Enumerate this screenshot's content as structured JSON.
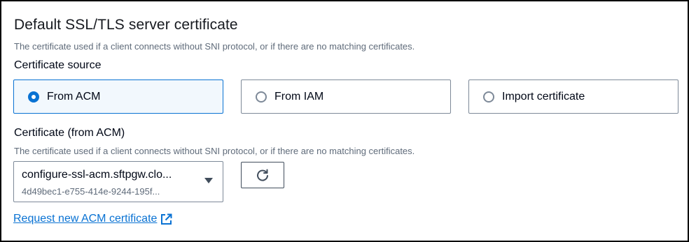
{
  "section": {
    "title": "Default SSL/TLS server certificate",
    "description": "The certificate used if a client connects without SNI protocol, or if there are no matching certificates."
  },
  "certificate_source": {
    "label": "Certificate source",
    "options": [
      {
        "label": "From ACM",
        "selected": true
      },
      {
        "label": "From IAM",
        "selected": false
      },
      {
        "label": "Import certificate",
        "selected": false
      }
    ]
  },
  "certificate": {
    "label": "Certificate (from ACM)",
    "description": "The certificate used if a client connects without SNI protocol, or if there are no matching certificates.",
    "selected_value": "configure-ssl-acm.sftpgw.clo...",
    "selected_id": "4d49bec1-e755-414e-9244-195f...",
    "dropdown_icon": "caret-down-icon",
    "refresh_icon": "refresh-icon"
  },
  "link": {
    "label": "Request new ACM certificate",
    "icon": "external-link-icon"
  },
  "colors": {
    "accent": "#0972d3",
    "selected_bg": "#f2f8fd",
    "text": "#000716",
    "muted": "#5f6b7a",
    "border": "#7d8998"
  }
}
